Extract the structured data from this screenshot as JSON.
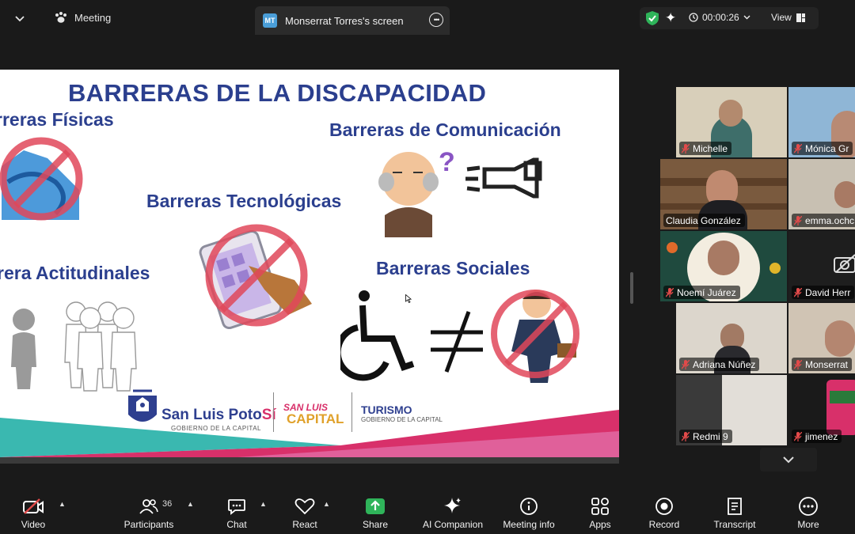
{
  "topbar": {
    "meeting_label": "Meeting",
    "screen_tab": {
      "initials": "MT",
      "label": "Monserrat Torres's screen"
    },
    "timer": "00:00:26",
    "view_label": "View"
  },
  "slide": {
    "title": "BARRERAS DE LA DISCAPACIDAD",
    "headings": {
      "fisicas": "rreras Físicas",
      "comunicacion": "Barreras de Comunicación",
      "tecnologicas": "Barreras Tecnológicas",
      "actitudinales": "rera Actitudinales",
      "sociales": "Barreras Sociales"
    },
    "logos": {
      "slp_main": "San Luis Poto",
      "slp_accent": "Sí",
      "slp_sub": "GOBIERNO DE LA CAPITAL",
      "capital_top": "SAN LUIS",
      "capital_bottom": "CAPITAL",
      "turismo": "TURISMO",
      "turismo_sub": "GOBIERNO DE LA CAPITAL"
    },
    "colors": {
      "title": "#2b3f8e",
      "pink": "#d8306a",
      "teal": "#3ab8b0",
      "prohibit": "#e0485a"
    }
  },
  "participants": [
    {
      "name": "Michelle"
    },
    {
      "name": "Mónica Gr"
    },
    {
      "name": "Claudia González"
    },
    {
      "name": "emma.ochc"
    },
    {
      "name": "Noemí Juárez"
    },
    {
      "name": "David Herr"
    },
    {
      "name": "Adriana Núñez"
    },
    {
      "name": "Monserrat"
    },
    {
      "name": "Redmi 9"
    },
    {
      "name": "jimenez"
    }
  ],
  "active_speaker_color": "#3fcf6c",
  "toolbar": {
    "video": "Video",
    "participants": "Participants",
    "participant_count": "36",
    "chat": "Chat",
    "react": "React",
    "share": "Share",
    "ai_companion": "AI Companion",
    "meeting_info": "Meeting info",
    "apps": "Apps",
    "record": "Record",
    "transcript": "Transcript",
    "more": "More"
  }
}
